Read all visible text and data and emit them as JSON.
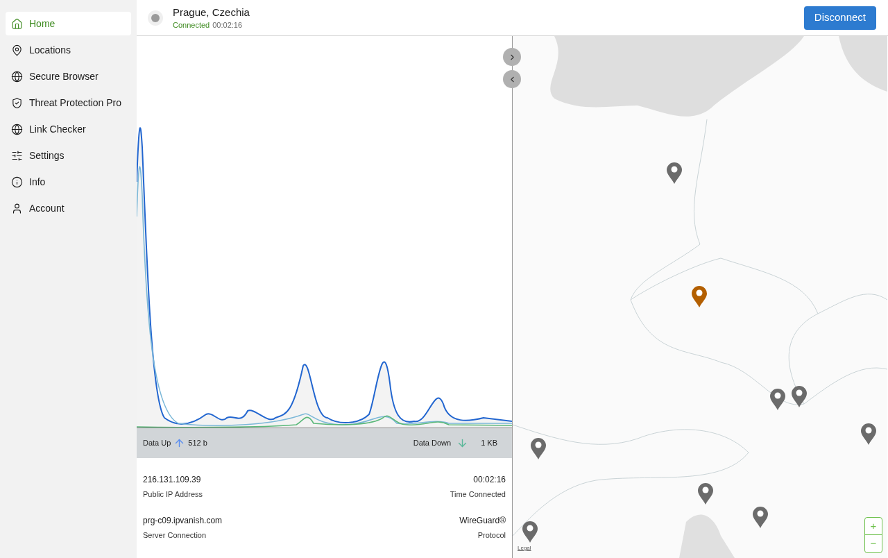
{
  "sidebar": {
    "items": [
      {
        "label": "Home",
        "selected": true
      },
      {
        "label": "Locations",
        "selected": false
      },
      {
        "label": "Secure Browser",
        "selected": false
      },
      {
        "label": "Threat Protection Pro",
        "selected": false
      },
      {
        "label": "Link Checker",
        "selected": false
      },
      {
        "label": "Settings",
        "selected": false
      },
      {
        "label": "Info",
        "selected": false
      },
      {
        "label": "Account",
        "selected": false
      }
    ]
  },
  "header": {
    "title": "Prague, Czechia",
    "status": "Connected",
    "time": "00:02:16",
    "button": "Disconnect"
  },
  "stats": {
    "up_label": "Data Up",
    "up_value": "512 b",
    "down_label": "Data Down",
    "down_value": "1 KB"
  },
  "details": [
    {
      "value": "216.131.109.39",
      "label": "Public IP Address"
    },
    {
      "value": "00:02:16",
      "label": "Time Connected"
    },
    {
      "value": "prg-c09.ipvanish.com",
      "label": "Server Connection"
    },
    {
      "value": "WireGuard®",
      "label": "Protocol"
    }
  ],
  "map": {
    "kind": "picture",
    "pins": [
      {
        "selected": false
      },
      {
        "selected": true
      },
      {
        "selected": false
      },
      {
        "selected": false
      },
      {
        "selected": false
      },
      {
        "selected": false
      },
      {
        "selected": false
      },
      {
        "selected": false
      },
      {
        "selected": false
      }
    ],
    "zoom_in": "+",
    "zoom_out": "−",
    "legal": "Legal"
  }
}
